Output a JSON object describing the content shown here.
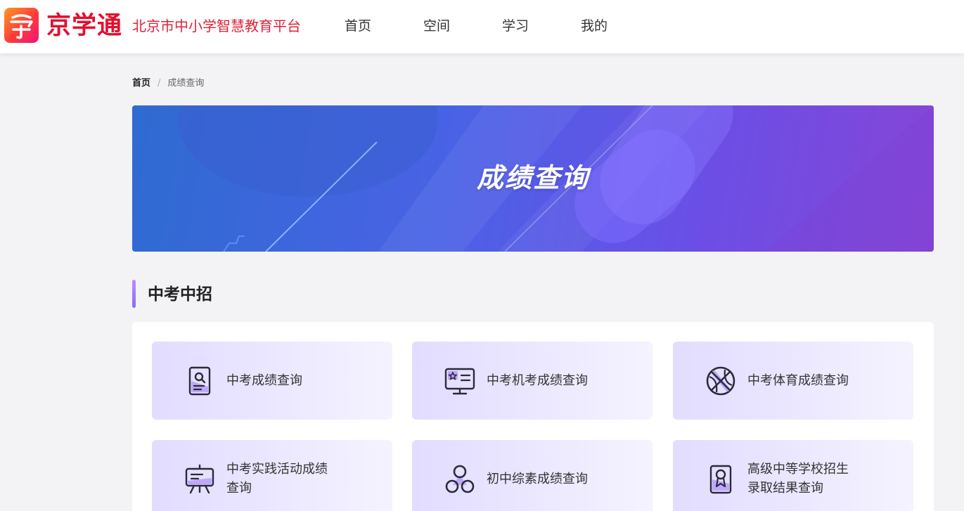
{
  "header": {
    "logo_mark_text": "学",
    "brand": "京学通",
    "tagline": "北京市中小学智慧教育平台",
    "nav": [
      "首页",
      "空间",
      "学习",
      "我的"
    ]
  },
  "breadcrumb": {
    "home": "首页",
    "separator": "/",
    "current": "成绩查询"
  },
  "banner": {
    "title": "成绩查询"
  },
  "section": {
    "title": "中考中招"
  },
  "cards": [
    {
      "label": "中考成绩查询",
      "icon": "id-card-search-icon"
    },
    {
      "label": "中考机考成绩查询",
      "icon": "computer-monitor-icon"
    },
    {
      "label": "中考体育成绩查询",
      "icon": "basketball-icon"
    },
    {
      "label": "中考实践活动成绩查询",
      "line1": "中考实践活动成绩",
      "line2": "查询",
      "icon": "presentation-easel-icon"
    },
    {
      "label": "初中综素成绩查询",
      "icon": "three-circles-icon"
    },
    {
      "label": "高级中等学校招生录取结果查询",
      "line1": "高级中等学校招生",
      "line2": "录取结果查询",
      "icon": "admission-certificate-icon"
    }
  ],
  "colors": {
    "brand_red": "#e60e2e",
    "accent_purple": "#8a6cf0",
    "card_bg": "#e8e4ff",
    "banner_start": "#2e6bd0",
    "banner_end": "#8645d6"
  }
}
